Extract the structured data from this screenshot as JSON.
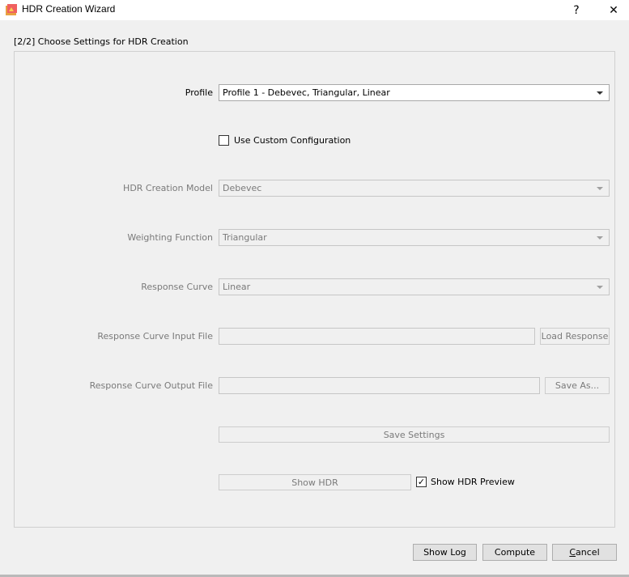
{
  "window": {
    "title": "HDR Creation Wizard",
    "help_glyph": "?",
    "close_glyph": "✕"
  },
  "header": {
    "step_label": "[2/2] Choose Settings for HDR Creation"
  },
  "form": {
    "profile": {
      "label": "Profile",
      "value": "Profile 1 - Debevec, Triangular, Linear"
    },
    "custom_config": {
      "label": "Use Custom Configuration",
      "checked": false
    },
    "creation_model": {
      "label": "HDR Creation Model",
      "value": "Debevec"
    },
    "weighting": {
      "label": "Weighting Function",
      "value": "Triangular"
    },
    "response_curve": {
      "label": "Response Curve",
      "value": "Linear"
    },
    "input_file": {
      "label": "Response Curve Input File",
      "value": "",
      "button": "Load Response"
    },
    "output_file": {
      "label": "Response Curve Output File",
      "value": "",
      "button": "Save As..."
    },
    "save_settings": "Save Settings",
    "show_hdr": "Show HDR",
    "show_preview": {
      "label": "Show HDR Preview",
      "checked": true,
      "mark": "✓"
    }
  },
  "footer": {
    "show_log": "Show Log",
    "compute": "Compute",
    "cancel_first": "C",
    "cancel_rest": "ancel"
  },
  "icons": {
    "app": "luminance-hdr-app-icon",
    "help": "help-icon",
    "close": "close-icon",
    "dropdown": "chevron-down-icon"
  }
}
